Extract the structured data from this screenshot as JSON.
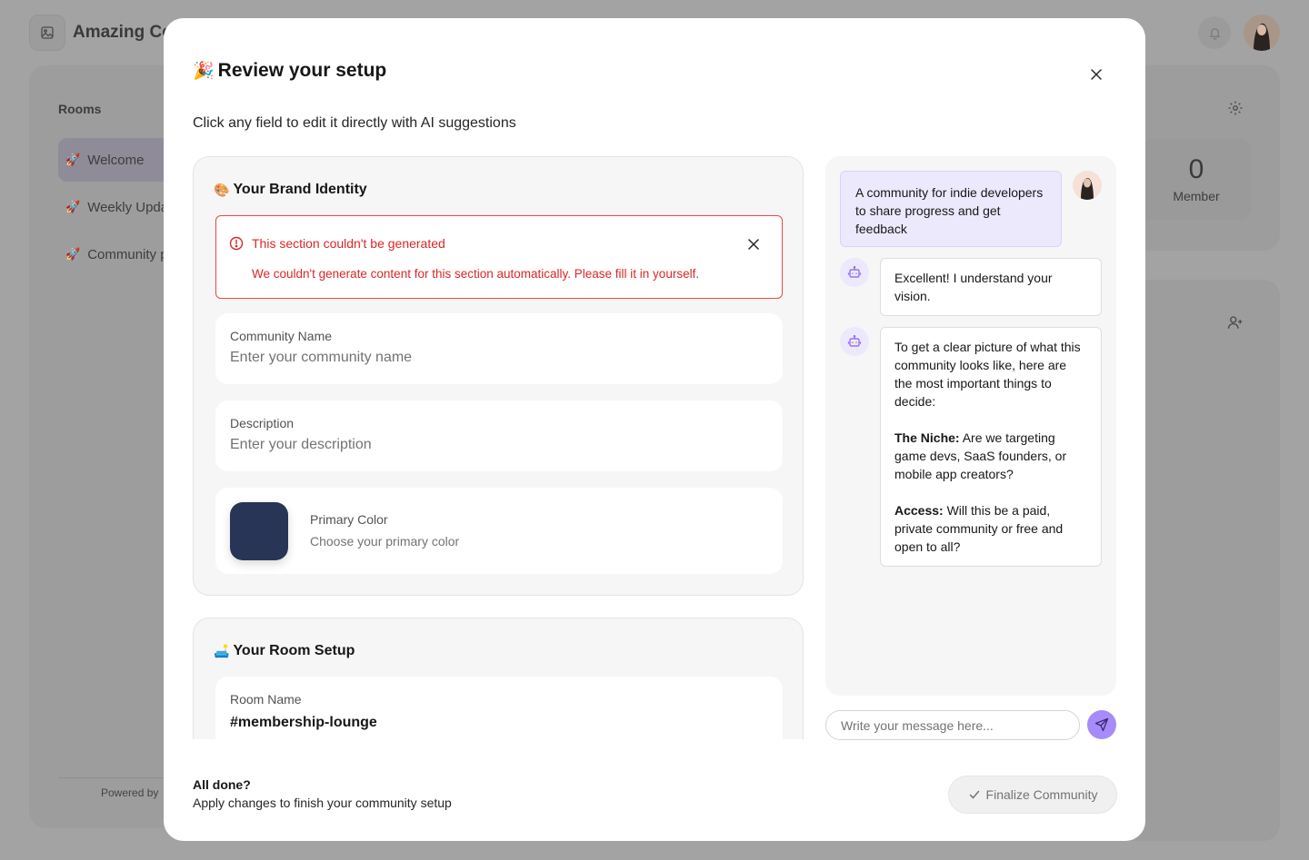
{
  "background": {
    "app_title": "Amazing Co",
    "rooms_label": "Rooms",
    "rooms": [
      {
        "emoji": "🚀",
        "label": "Welcome"
      },
      {
        "emoji": "🚀",
        "label": "Weekly Upda"
      },
      {
        "emoji": "🚀",
        "label": "Community p"
      }
    ],
    "member_count": "0",
    "member_label": "Member",
    "powered_by": "Powered by"
  },
  "modal": {
    "title_emoji": "🎉",
    "title": "Review your setup",
    "subtitle": "Click any field to edit it directly with AI suggestions"
  },
  "brand_section": {
    "emoji": "🎨",
    "title": "Your Brand Identity",
    "error_title": "This section couldn't be generated",
    "error_message": "We couldn't generate content for this section automatically. Please fill it in yourself.",
    "community_name_label": "Community Name",
    "community_name_placeholder": "Enter your community name",
    "community_name_value": "",
    "description_label": "Description",
    "description_placeholder": "Enter your description",
    "description_value": "",
    "primary_color_label": "Primary Color",
    "primary_color_hint": "Choose your primary color",
    "primary_color": "#283556"
  },
  "room_section": {
    "emoji": "🛋️",
    "title": "Your Room Setup",
    "room_name_label": "Room Name",
    "room_name_value": "#membership-lounge"
  },
  "chat": {
    "user_message": "A community for indie developers to share progress and get feedback",
    "bot_message_1": "Excellent! I understand your vision.",
    "bot_message_2_intro": "To get a clear picture of what this community looks like, here are the most important things to decide:",
    "bot_message_2_niche_label": "The Niche:",
    "bot_message_2_niche_text": "Are we targeting game devs, SaaS founders, or mobile app creators?",
    "bot_message_2_access_label": "Access:",
    "bot_message_2_access_text": "Will this be a paid, private community or free and open to all?",
    "input_placeholder": "Write your message here..."
  },
  "footer": {
    "title": "All done?",
    "subtitle": "Apply changes to finish your community setup",
    "finalize_label": "Finalize Community"
  },
  "colors": {
    "accent": "#a78bfa",
    "error": "#dc2626",
    "user_bubble": "#ece9fd"
  }
}
